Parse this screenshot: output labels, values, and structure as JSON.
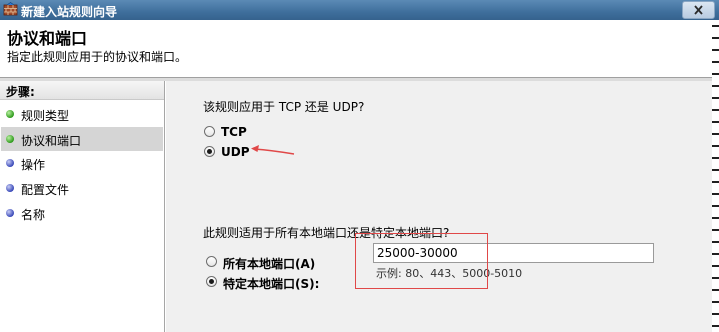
{
  "window": {
    "title": "新建入站规则向导",
    "header_title": "协议和端口",
    "header_subtitle": "指定此规则应用于的协议和端口。"
  },
  "sidebar": {
    "heading": "步骤:",
    "steps": [
      {
        "label": "规则类型",
        "state": "done"
      },
      {
        "label": "协议和端口",
        "state": "current"
      },
      {
        "label": "操作",
        "state": "pending"
      },
      {
        "label": "配置文件",
        "state": "pending"
      },
      {
        "label": "名称",
        "state": "pending"
      }
    ]
  },
  "protocol": {
    "question": "该规则应用于 TCP 还是 UDP?",
    "options": [
      {
        "label": "TCP",
        "selected": false
      },
      {
        "label": "UDP",
        "selected": true
      }
    ]
  },
  "ports": {
    "question": "此规则适用于所有本地端口还是特定本地端口?",
    "all_ports_label": "所有本地端口(A)",
    "specific_ports_label": "特定本地端口(S):",
    "specific_selected": true,
    "value": "25000-30000",
    "example": "示例: 80、443、5000-5010"
  },
  "colors": {
    "annotation": "#e04848",
    "step_done": "#2e9a1c",
    "step_pending": "#3848b8"
  }
}
